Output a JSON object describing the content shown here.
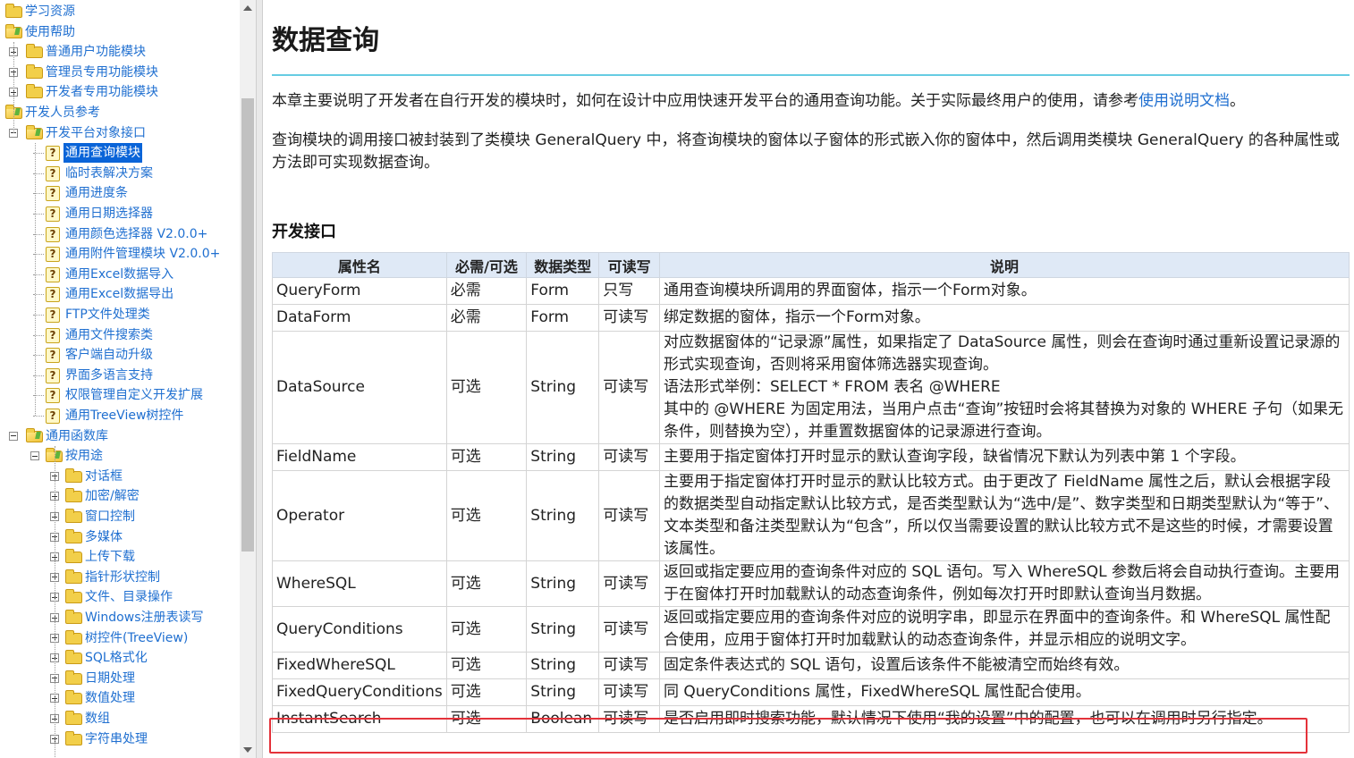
{
  "tree": {
    "items": [
      {
        "label": "学习资源",
        "icon": "folder-icon",
        "indent": 0,
        "toggle": "none"
      },
      {
        "label": "使用帮助",
        "icon": "folder-open-icon",
        "indent": 0,
        "toggle": "none"
      },
      {
        "label": "普通用户功能模块",
        "icon": "folder-icon",
        "indent": 1,
        "toggle": "plus"
      },
      {
        "label": "管理员专用功能模块",
        "icon": "folder-icon",
        "indent": 1,
        "toggle": "plus"
      },
      {
        "label": "开发者专用功能模块",
        "icon": "folder-icon",
        "indent": 1,
        "toggle": "plus"
      },
      {
        "label": "开发人员参考",
        "icon": "folder-open-icon",
        "indent": 0,
        "toggle": "none"
      },
      {
        "label": "开发平台对象接口",
        "icon": "folder-open-icon",
        "indent": 1,
        "toggle": "minus"
      },
      {
        "label": "通用查询模块",
        "icon": "help-page-icon",
        "indent": 2,
        "toggle": "none",
        "selected": true
      },
      {
        "label": "临时表解决方案",
        "icon": "help-page-icon",
        "indent": 2,
        "toggle": "none"
      },
      {
        "label": "通用进度条",
        "icon": "help-page-icon",
        "indent": 2,
        "toggle": "none"
      },
      {
        "label": "通用日期选择器",
        "icon": "help-page-icon",
        "indent": 2,
        "toggle": "none"
      },
      {
        "label": "通用颜色选择器 V2.0.0+",
        "icon": "help-page-icon",
        "indent": 2,
        "toggle": "none"
      },
      {
        "label": "通用附件管理模块 V2.0.0+",
        "icon": "help-page-icon",
        "indent": 2,
        "toggle": "none"
      },
      {
        "label": "通用Excel数据导入",
        "icon": "help-page-icon",
        "indent": 2,
        "toggle": "none"
      },
      {
        "label": "通用Excel数据导出",
        "icon": "help-page-icon",
        "indent": 2,
        "toggle": "none"
      },
      {
        "label": "FTP文件处理类",
        "icon": "help-page-icon",
        "indent": 2,
        "toggle": "none"
      },
      {
        "label": "通用文件搜索类",
        "icon": "help-page-icon",
        "indent": 2,
        "toggle": "none"
      },
      {
        "label": "客户端自动升级",
        "icon": "help-page-icon",
        "indent": 2,
        "toggle": "none"
      },
      {
        "label": "界面多语言支持",
        "icon": "help-page-icon",
        "indent": 2,
        "toggle": "none"
      },
      {
        "label": "权限管理自定义开发扩展",
        "icon": "help-page-icon",
        "indent": 2,
        "toggle": "none"
      },
      {
        "label": "通用TreeView树控件",
        "icon": "help-page-icon",
        "indent": 2,
        "toggle": "none"
      },
      {
        "label": "通用函数库",
        "icon": "folder-open-icon",
        "indent": 1,
        "toggle": "minus"
      },
      {
        "label": "按用途",
        "icon": "folder-open-icon",
        "indent": 2,
        "toggle": "minus"
      },
      {
        "label": "对话框",
        "icon": "folder-icon",
        "indent": 3,
        "toggle": "plus"
      },
      {
        "label": "加密/解密",
        "icon": "folder-icon",
        "indent": 3,
        "toggle": "plus"
      },
      {
        "label": "窗口控制",
        "icon": "folder-icon",
        "indent": 3,
        "toggle": "plus"
      },
      {
        "label": "多媒体",
        "icon": "folder-icon",
        "indent": 3,
        "toggle": "plus"
      },
      {
        "label": "上传下载",
        "icon": "folder-icon",
        "indent": 3,
        "toggle": "plus"
      },
      {
        "label": "指针形状控制",
        "icon": "folder-icon",
        "indent": 3,
        "toggle": "plus"
      },
      {
        "label": "文件、目录操作",
        "icon": "folder-icon",
        "indent": 3,
        "toggle": "plus"
      },
      {
        "label": "Windows注册表读写",
        "icon": "folder-icon",
        "indent": 3,
        "toggle": "plus"
      },
      {
        "label": "树控件(TreeView)",
        "icon": "folder-icon",
        "indent": 3,
        "toggle": "plus"
      },
      {
        "label": "SQL格式化",
        "icon": "folder-icon",
        "indent": 3,
        "toggle": "plus"
      },
      {
        "label": "日期处理",
        "icon": "folder-icon",
        "indent": 3,
        "toggle": "plus"
      },
      {
        "label": "数值处理",
        "icon": "folder-icon",
        "indent": 3,
        "toggle": "plus"
      },
      {
        "label": "数组",
        "icon": "folder-icon",
        "indent": 3,
        "toggle": "plus"
      },
      {
        "label": "字符串处理",
        "icon": "folder-icon",
        "indent": 3,
        "toggle": "plus"
      }
    ]
  },
  "page": {
    "title": "数据查询",
    "intro_text": "本章主要说明了开发者在自行开发的模块时，如何在设计中应用快速开发平台的通用查询功能。关于实际最终用户的使用，请参考",
    "intro_link": "使用说明文档",
    "intro_end": "。",
    "para2": "查询模块的调用接口被封装到了类模块 GeneralQuery 中，将查询模块的窗体以子窗体的形式嵌入你的窗体中，然后调用类模块 GeneralQuery 的各种属性或方法即可实现数据查询。",
    "section_heading": "开发接口"
  },
  "table": {
    "headers": [
      "属性名",
      "必需/可选",
      "数据类型",
      "可读写",
      "说明"
    ],
    "rows": [
      {
        "name": "QueryForm",
        "required": "必需",
        "type": "Form",
        "rw": "只写",
        "desc": [
          "通用查询模块所调用的界面窗体，指示一个Form对象。"
        ]
      },
      {
        "name": "DataForm",
        "required": "必需",
        "type": "Form",
        "rw": "可读写",
        "desc": [
          "绑定数据的窗体，指示一个Form对象。"
        ]
      },
      {
        "name": "DataSource",
        "required": "可选",
        "type": "String",
        "rw": "可读写",
        "desc": [
          "对应数据窗体的“记录源”属性，如果指定了 DataSource 属性，则会在查询时通过重新设置记录源的形式实现查询，否则将采用窗体筛选器实现查询。",
          "语法形式举例：SELECT * FROM 表名 @WHERE",
          "其中的 @WHERE 为固定用法，当用户点击“查询”按钮时会将其替换为对象的 WHERE 子句（如果无条件，则替换为空），并重置数据窗体的记录源进行查询。"
        ]
      },
      {
        "name": "FieldName",
        "required": "可选",
        "type": "String",
        "rw": "可读写",
        "desc": [
          "主要用于指定窗体打开时显示的默认查询字段，缺省情况下默认为列表中第 1 个字段。"
        ]
      },
      {
        "name": "Operator",
        "required": "可选",
        "type": "String",
        "rw": "可读写",
        "desc": [
          "主要用于指定窗体打开时显示的默认比较方式。由于更改了 FieldName 属性之后，默认会根据字段的数据类型自动指定默认比较方式，是否类型默认为“选中/是”、数字类型和日期类型默认为“等于”、文本类型和备注类型默认为“包含”，所以仅当需要设置的默认比较方式不是这些的时候，才需要设置该属性。"
        ]
      },
      {
        "name": "WhereSQL",
        "required": "可选",
        "type": "String",
        "rw": "可读写",
        "desc": [
          "返回或指定要应用的查询条件对应的 SQL 语句。写入 WhereSQL 参数后将会自动执行查询。主要用于在窗体打开时加载默认的动态查询条件，例如每次打开时即默认查询当月数据。"
        ]
      },
      {
        "name": "QueryConditions",
        "required": "可选",
        "type": "String",
        "rw": "可读写",
        "desc": [
          "返回或指定要应用的查询条件对应的说明字串，即显示在界面中的查询条件。和 WhereSQL 属性配合使用，应用于窗体打开时加载默认的动态查询条件，并显示相应的说明文字。"
        ]
      },
      {
        "name": "FixedWhereSQL",
        "required": "可选",
        "type": "String",
        "rw": "可读写",
        "desc": [
          "固定条件表达式的 SQL 语句，设置后该条件不能被清空而始终有效。"
        ]
      },
      {
        "name": "FixedQueryConditions",
        "required": "可选",
        "type": "String",
        "rw": "可读写",
        "desc": [
          "同 QueryConditions 属性，FixedWhereSQL 属性配合使用。"
        ]
      },
      {
        "name": "InstantSearch",
        "required": "可选",
        "type": "Boolean",
        "rw": "可读写",
        "desc": [
          "是否启用即时搜索功能，默认情况下使用“我的设置”中的配置，也可以在调用时另行指定。"
        ]
      }
    ]
  },
  "colors": {
    "link": "#1f6fd0",
    "selection": "#0a64d8",
    "title_rule": "#66cce3",
    "table_header": "#dfe9f6",
    "highlight": "#e4323a"
  }
}
